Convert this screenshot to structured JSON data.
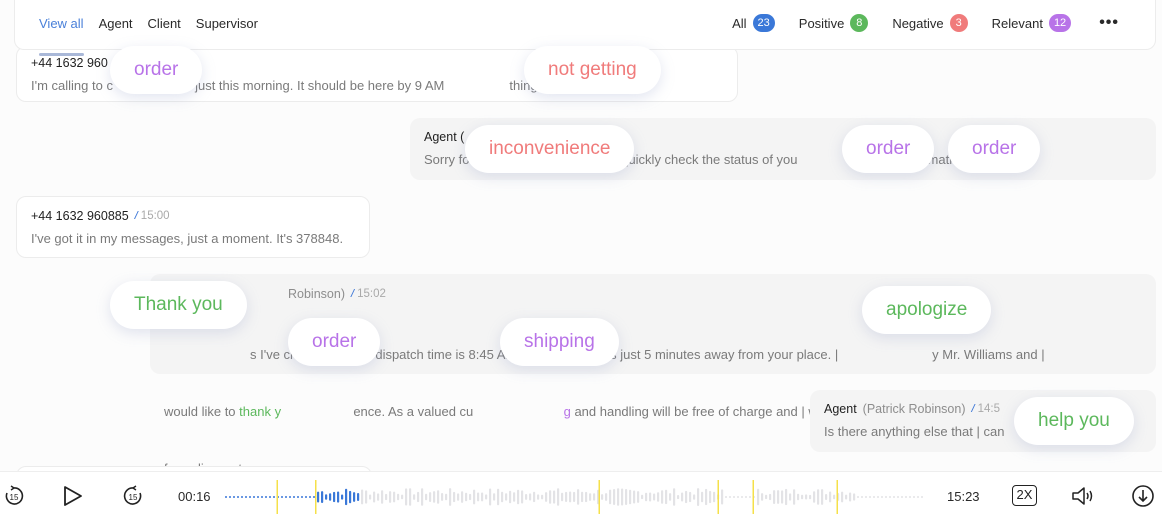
{
  "header": {
    "tabs": [
      {
        "label": "View all",
        "active": true
      },
      {
        "label": "Agent",
        "active": false
      },
      {
        "label": "Client",
        "active": false
      },
      {
        "label": "Supervisor",
        "active": false
      }
    ],
    "filters": [
      {
        "label": "All",
        "count": "23",
        "color": "#3a78d8"
      },
      {
        "label": "Positive",
        "count": "8",
        "color": "#5cb85c"
      },
      {
        "label": "Negative",
        "count": "3",
        "color": "#f07b7b"
      },
      {
        "label": "Relevant",
        "count": "12",
        "color": "#b873e8"
      }
    ],
    "more_icon": "more-horizontal-icon"
  },
  "messages": [
    {
      "role": "client",
      "sender": "+44 1632 960",
      "text": "I'm calling to c       r | placed just this morning. It should be here by 9 AM                  thing yet."
    },
    {
      "role": "agent",
      "sender": "Agent (",
      "text": "Sorry fo                                    me quickly check the status of you                                    mation number?"
    },
    {
      "role": "client",
      "sender": "+44 1632 960885",
      "time": "15:00",
      "text": "I've got it in my messages, just a moment. It's 378848."
    },
    {
      "role": "agent",
      "sender_sub": "Robinson)",
      "time": "15:02",
      "line1": "s I've checked on the dispatch time is 8:45 AM, and our driver is just 5 minutes away from your place. |                          y Mr. Williams and |",
      "line2_pre": "would like to ",
      "line2_hl": "thank y",
      "line2_mid": "                    ence. As a valued cu                         ",
      "line2_hl2": "g",
      "line2_post": " and handling will be free of charge and | will send you an SMS with a promo code",
      "line3": "for a discount on you"
    },
    {
      "role": "agent",
      "sender": "Agent",
      "sender_sub": "(Patrick Robinson)",
      "time": "14:5",
      "text": "Is there anything else that | can                              ?"
    }
  ],
  "keywords": [
    {
      "word": "order",
      "sentiment": "relevant"
    },
    {
      "word": "not getting",
      "sentiment": "negative"
    },
    {
      "word": "inconvenience",
      "sentiment": "negative"
    },
    {
      "word": "order",
      "sentiment": "relevant"
    },
    {
      "word": "order",
      "sentiment": "relevant"
    },
    {
      "word": "Thank you",
      "sentiment": "positive"
    },
    {
      "word": "order",
      "sentiment": "relevant"
    },
    {
      "word": "shipping",
      "sentiment": "relevant"
    },
    {
      "word": "apologize",
      "sentiment": "positive"
    },
    {
      "word": "help you",
      "sentiment": "positive"
    }
  ],
  "player": {
    "rewind_label": "15",
    "forward_label": "15",
    "current_time": "00:16",
    "total_time": "15:23",
    "speed": "2X",
    "progress": 0.19,
    "played_color": "#3a78d8",
    "marker_color": "#f5e04a",
    "markers": [
      0.075,
      0.13,
      0.535,
      0.705,
      0.755,
      0.875
    ]
  }
}
